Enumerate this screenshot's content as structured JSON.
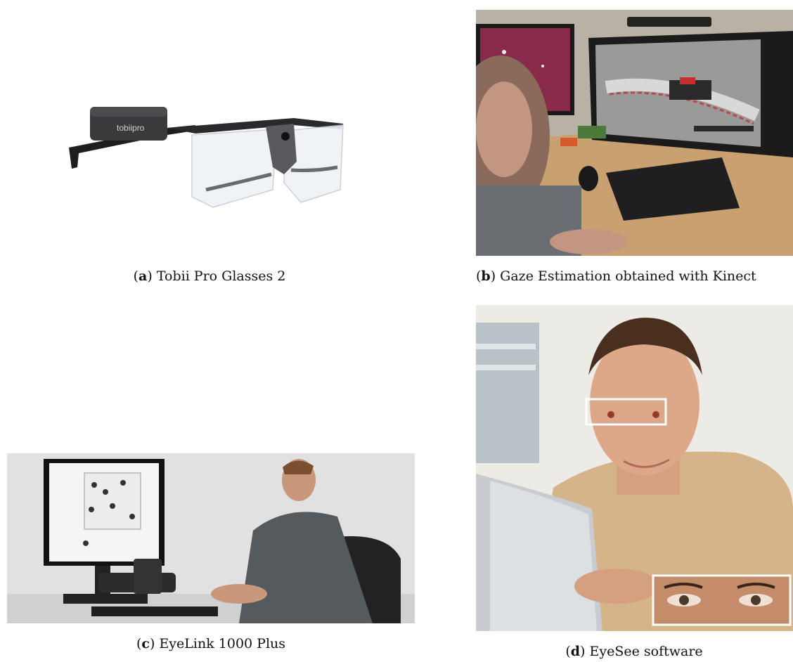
{
  "figure": {
    "panels": [
      {
        "label": "a",
        "caption": "Tobii Pro Glasses 2",
        "brand_text": "tobiipro"
      },
      {
        "label": "b",
        "caption": "Gaze Estimation obtained with Kinect"
      },
      {
        "label": "c",
        "caption": "EyeLink 1000 Plus"
      },
      {
        "label": "d",
        "caption": "EyeSee software"
      }
    ]
  },
  "colors": {
    "eye_box": "#ffffff",
    "desk": "#c9a070",
    "wall_d": "#ecebe6"
  }
}
